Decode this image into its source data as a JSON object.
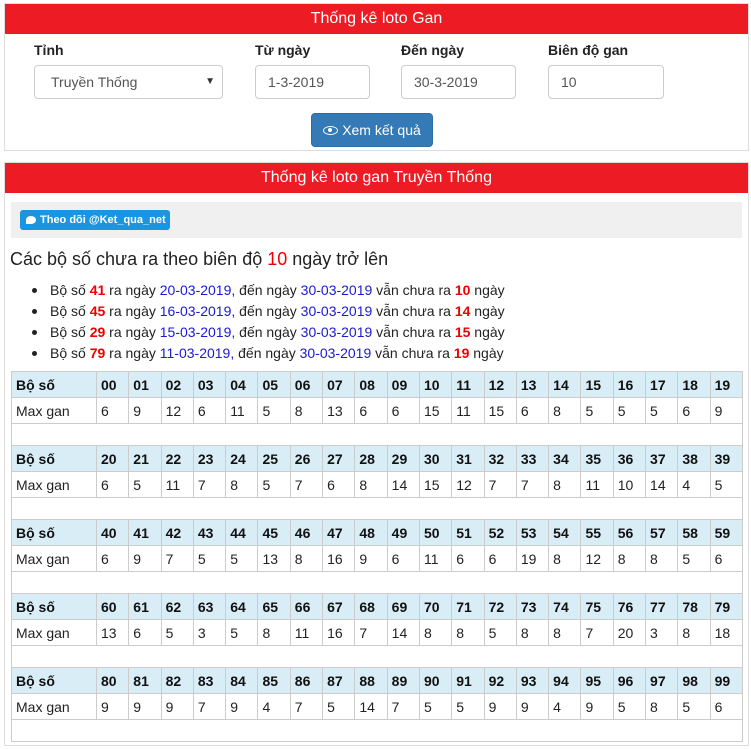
{
  "filter": {
    "title": "Thống kê loto Gan",
    "province_label": "Tỉnh",
    "province_value": "Truyền Thống",
    "from_label": "Từ ngày",
    "from_value": "1-3-2019",
    "to_label": "Đến ngày",
    "to_value": "30-3-2019",
    "range_label": "Biên độ gan",
    "range_value": "10",
    "submit_label": "Xem kết quả"
  },
  "result": {
    "title": "Thống kê loto gan Truyền Thống",
    "twitter_label": "Theo dõi @Ket_qua_net",
    "headline_pre": "Các bộ số chưa ra theo biên độ ",
    "headline_num": "10",
    "headline_post": " ngày trở lên",
    "stats": [
      {
        "pre": "Bộ số ",
        "num": "41",
        "mid1": " ra ngày ",
        "from": "20-03-2019,",
        "mid2": " đến ngày ",
        "to": "30-03-2019",
        "mid3": " vẫn chưa ra ",
        "days": "10",
        "post": " ngày"
      },
      {
        "pre": "Bộ số ",
        "num": "45",
        "mid1": " ra ngày ",
        "from": "16-03-2019,",
        "mid2": " đến ngày ",
        "to": "30-03-2019",
        "mid3": " vẫn chưa ra ",
        "days": "14",
        "post": " ngày"
      },
      {
        "pre": "Bộ số ",
        "num": "29",
        "mid1": " ra ngày ",
        "from": "15-03-2019,",
        "mid2": " đến ngày ",
        "to": "30-03-2019",
        "mid3": " vẫn chưa ra ",
        "days": "15",
        "post": " ngày"
      },
      {
        "pre": "Bộ số ",
        "num": "79",
        "mid1": " ra ngày ",
        "from": "11-03-2019,",
        "mid2": " đến ngày ",
        "to": "30-03-2019",
        "mid3": " vẫn chưa ra ",
        "days": "19",
        "post": " ngày"
      }
    ],
    "table": {
      "header_label": "Bộ số",
      "row_label": "Max gan",
      "blocks": [
        {
          "numbers": [
            "00",
            "01",
            "02",
            "03",
            "04",
            "05",
            "06",
            "07",
            "08",
            "09",
            "10",
            "11",
            "12",
            "13",
            "14",
            "15",
            "16",
            "17",
            "18",
            "19"
          ],
          "values": [
            "6",
            "9",
            "12",
            "6",
            "11",
            "5",
            "8",
            "13",
            "6",
            "6",
            "15",
            "11",
            "15",
            "6",
            "8",
            "5",
            "5",
            "5",
            "6",
            "9"
          ]
        },
        {
          "numbers": [
            "20",
            "21",
            "22",
            "23",
            "24",
            "25",
            "26",
            "27",
            "28",
            "29",
            "30",
            "31",
            "32",
            "33",
            "34",
            "35",
            "36",
            "37",
            "38",
            "39"
          ],
          "values": [
            "6",
            "5",
            "11",
            "7",
            "8",
            "5",
            "7",
            "6",
            "8",
            "14",
            "15",
            "12",
            "7",
            "7",
            "8",
            "11",
            "10",
            "14",
            "4",
            "5"
          ]
        },
        {
          "numbers": [
            "40",
            "41",
            "42",
            "43",
            "44",
            "45",
            "46",
            "47",
            "48",
            "49",
            "50",
            "51",
            "52",
            "53",
            "54",
            "55",
            "56",
            "57",
            "58",
            "59"
          ],
          "values": [
            "6",
            "9",
            "7",
            "5",
            "5",
            "13",
            "8",
            "16",
            "9",
            "6",
            "11",
            "6",
            "6",
            "19",
            "8",
            "12",
            "8",
            "8",
            "5",
            "6"
          ]
        },
        {
          "numbers": [
            "60",
            "61",
            "62",
            "63",
            "64",
            "65",
            "66",
            "67",
            "68",
            "69",
            "70",
            "71",
            "72",
            "73",
            "74",
            "75",
            "76",
            "77",
            "78",
            "79"
          ],
          "values": [
            "13",
            "6",
            "5",
            "3",
            "5",
            "8",
            "11",
            "16",
            "7",
            "14",
            "8",
            "8",
            "5",
            "8",
            "8",
            "7",
            "20",
            "3",
            "8",
            "18"
          ]
        },
        {
          "numbers": [
            "80",
            "81",
            "82",
            "83",
            "84",
            "85",
            "86",
            "87",
            "88",
            "89",
            "90",
            "91",
            "92",
            "93",
            "94",
            "95",
            "96",
            "97",
            "98",
            "99"
          ],
          "values": [
            "9",
            "9",
            "9",
            "7",
            "9",
            "4",
            "7",
            "5",
            "14",
            "7",
            "5",
            "5",
            "9",
            "9",
            "4",
            "9",
            "5",
            "8",
            "5",
            "6"
          ]
        }
      ]
    }
  }
}
